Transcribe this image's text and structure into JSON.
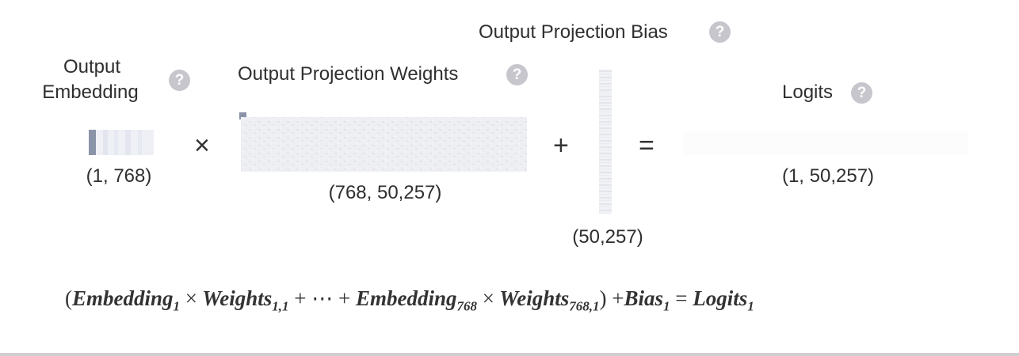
{
  "labels": {
    "output_embedding_line1": "Output",
    "output_embedding_line2": "Embedding",
    "weights": "Output Projection Weights",
    "bias": "Output Projection Bias",
    "logits": "Logits"
  },
  "help_glyph": "?",
  "shapes": {
    "embedding": "(1, 768)",
    "weights": "(768, 50,257)",
    "bias": "(50,257)",
    "logits": "(1, 50,257)"
  },
  "operators": {
    "multiply": "×",
    "plus": "+",
    "equals": "="
  },
  "equation": {
    "open": "(",
    "embedding": "Embedding",
    "embedding_sub1": "1",
    "times1": "×",
    "weights": "Weights",
    "weights_sub1": "1,1",
    "plus_dots": "+ ⋯ +",
    "embedding_sub768": "768",
    "times2": "×",
    "weights_sub768": "768,1",
    "close_plus": ") +",
    "bias": "Bias",
    "bias_sub": "1",
    "equals": "=",
    "logits": "Logits",
    "logits_sub": "1"
  },
  "colors": {
    "help_icon": "#c6c6cc",
    "matrix_accent": "#8a93a8",
    "matrix_light": "#e6e8ef"
  }
}
